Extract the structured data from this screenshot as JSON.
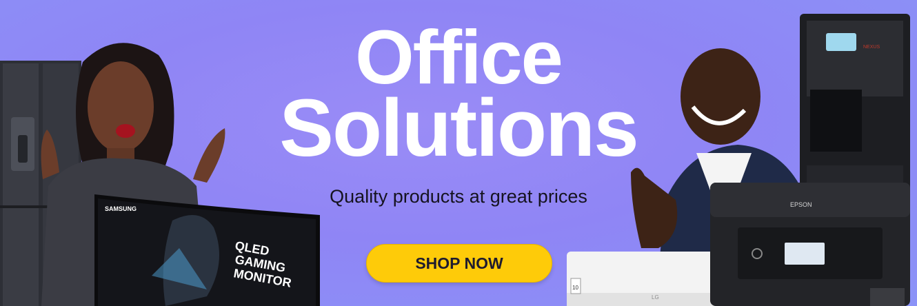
{
  "banner": {
    "headline_line1": "Office",
    "headline_line2": "Solutions",
    "subtitle": "Quality products at great prices",
    "cta_label": "SHOP NOW"
  },
  "products": {
    "monitor": {
      "brand": "SAMSUNG",
      "screen_line1": "QLED",
      "screen_line2": "GAMING",
      "screen_line3": "MONITOR"
    },
    "printer": {
      "brand": "EPSON"
    },
    "air_conditioner": {
      "brand": "LG",
      "energy_label": "10"
    },
    "water_dispenser": {
      "brand": "NEXUS"
    }
  },
  "colors": {
    "background": "#8f8af6",
    "cta": "#fecb09",
    "headline": "#ffffff"
  }
}
